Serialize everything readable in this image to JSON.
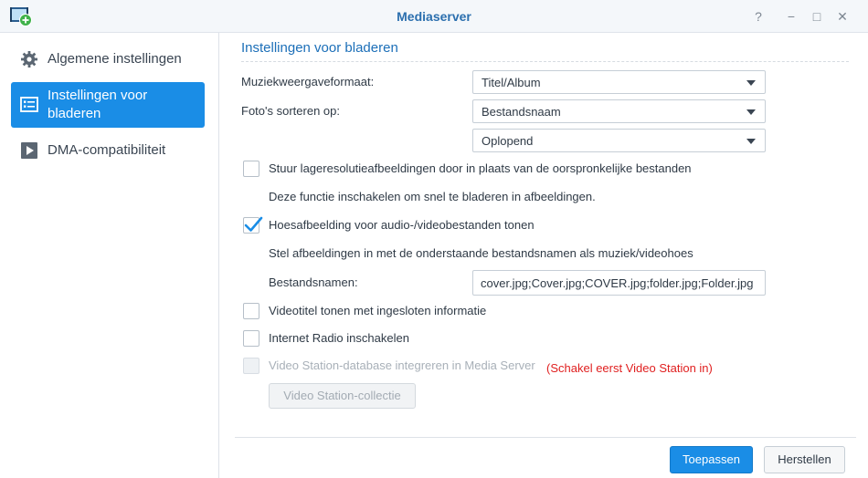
{
  "window": {
    "title": "Mediaserver",
    "controls": {
      "help": "?",
      "minimize": "−",
      "maximize": "□",
      "close": "✕"
    },
    "app_icon": "mediaserver-app-icon"
  },
  "sidebar": {
    "items": [
      {
        "label": "Algemene instellingen",
        "icon": "gear-icon",
        "active": false
      },
      {
        "label": "Instellingen voor bladeren",
        "icon": "browse-list-icon",
        "active": true
      },
      {
        "label": "DMA-compatibiliteit",
        "icon": "play-icon",
        "active": false
      }
    ]
  },
  "main": {
    "section_title": "Instellingen voor bladeren",
    "music_format": {
      "label": "Muziekweergaveformaat:",
      "value": "Titel/Album"
    },
    "photo_sort": {
      "label": "Foto's sorteren op:",
      "value": "Bestandsnaam",
      "order_value": "Oplopend"
    },
    "low_res": {
      "label": "Stuur lageresolutieafbeeldingen door in plaats van de oorspronkelijke bestanden",
      "checked": false,
      "note": "Deze functie inschakelen om snel te bladeren in afbeeldingen."
    },
    "cover_art": {
      "label": "Hoesafbeelding voor audio-/videobestanden tonen",
      "checked": true,
      "note": "Stel afbeeldingen in met de onderstaande bestandsnamen als muziek/videohoes",
      "filenames_label": "Bestandsnamen:",
      "filenames_value": "cover.jpg;Cover.jpg;COVER.jpg;folder.jpg;Folder.jpg"
    },
    "video_title": {
      "label": "Videotitel tonen met ingesloten informatie",
      "checked": false
    },
    "internet_radio": {
      "label": "Internet Radio inschakelen",
      "checked": false
    },
    "video_station": {
      "label": "Video Station-database integreren in Media Server",
      "warning": "(Schakel eerst Video Station in)",
      "checked": false,
      "disabled": true,
      "collection_button": "Video Station-collectie"
    }
  },
  "footer": {
    "apply": "Toepassen",
    "reset": "Herstellen"
  },
  "colors": {
    "accent": "#1a8de6",
    "title": "#2b6fae",
    "warning": "#e02020"
  }
}
